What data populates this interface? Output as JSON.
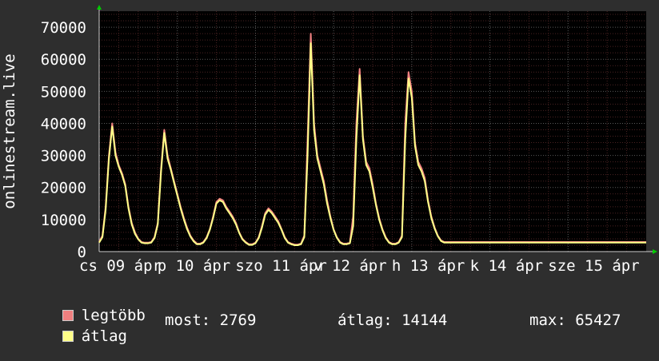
{
  "chart_data": {
    "type": "line",
    "ylabel": "onlinestream.live",
    "ylim": [
      0,
      75000
    ],
    "yticks": [
      0,
      10000,
      20000,
      30000,
      40000,
      50000,
      60000,
      70000
    ],
    "ytick_labels": [
      "0",
      "10000",
      "20000",
      "30000",
      "40000",
      "50000",
      "60000",
      "70000"
    ],
    "xlim": [
      0,
      168
    ],
    "xtick_labels": [
      {
        "x": 0,
        "text": "cs 09 ápr"
      },
      {
        "x": 24,
        "text": "p 10 ápr"
      },
      {
        "x": 48,
        "text": "szo 11 ápr"
      },
      {
        "x": 72,
        "text": "v 12 ápr"
      },
      {
        "x": 96,
        "text": "h 13 ápr"
      },
      {
        "x": 120,
        "text": "k 14 ápr"
      },
      {
        "x": 144,
        "text": "sze 15 ápr"
      }
    ],
    "grid": true,
    "colors": {
      "background": "#2e2e2e",
      "plot_background": "#000000",
      "grid_minor": "#4a2222",
      "grid_major": "#5a5a5a",
      "max_line": "#f08080",
      "avg_line": "#ffff88",
      "axis": "#cccccc",
      "arrow": "#00cc00"
    },
    "series": [
      {
        "name": "legtöbb",
        "color": "#f08080",
        "x": [
          0,
          1,
          2,
          3,
          4,
          5,
          6,
          7,
          8,
          9,
          10,
          11,
          12,
          13,
          14,
          15,
          16,
          17,
          18,
          19,
          20,
          21,
          22,
          23,
          24,
          25,
          26,
          27,
          28,
          29,
          30,
          31,
          32,
          33,
          34,
          35,
          36,
          37,
          38,
          39,
          40,
          41,
          42,
          43,
          44,
          45,
          46,
          47,
          48,
          49,
          50,
          51,
          52,
          53,
          54,
          55,
          56,
          57,
          58,
          59,
          60,
          61,
          62,
          63,
          64,
          65,
          66,
          67,
          68,
          69,
          70,
          71,
          72,
          73,
          74,
          75,
          76,
          77,
          78,
          79,
          80,
          81,
          82,
          83,
          84,
          85,
          86,
          87,
          88,
          89,
          90,
          91,
          92,
          93,
          94,
          95,
          96,
          97,
          98,
          99,
          100,
          101,
          102,
          103,
          104,
          105,
          106,
          107,
          108,
          109,
          110,
          111,
          112,
          113,
          114,
          115,
          116,
          117,
          118,
          119,
          120,
          121,
          122,
          123,
          124,
          125,
          126,
          127,
          128,
          129,
          130,
          131,
          132,
          133,
          134,
          135,
          136,
          137,
          138,
          139,
          140,
          141,
          142,
          143,
          144,
          145,
          146,
          147,
          148,
          149,
          150,
          151,
          152,
          153,
          154,
          155,
          156,
          157,
          158,
          159,
          160,
          161,
          162,
          163,
          164,
          165,
          166,
          167,
          168
        ],
        "values": [
          3000,
          5000,
          14000,
          30000,
          40000,
          31000,
          27000,
          24500,
          21000,
          14000,
          9000,
          6000,
          4000,
          3000,
          2800,
          2800,
          3000,
          4500,
          9000,
          26000,
          38000,
          30000,
          26000,
          22000,
          18000,
          14000,
          10500,
          7500,
          5000,
          3500,
          2500,
          2500,
          3000,
          4500,
          7000,
          11000,
          15500,
          16500,
          16000,
          14000,
          12500,
          11000,
          9000,
          6000,
          4000,
          3000,
          2300,
          2300,
          2800,
          4500,
          8000,
          12000,
          13500,
          12500,
          11000,
          9500,
          7000,
          4500,
          3000,
          2500,
          2200,
          2200,
          2500,
          5000,
          35000,
          68000,
          40000,
          30000,
          26000,
          22000,
          16000,
          11000,
          7000,
          4500,
          3000,
          2500,
          2500,
          2800,
          11000,
          40000,
          57000,
          36000,
          28000,
          26000,
          21000,
          15000,
          10500,
          7000,
          4500,
          3000,
          2500,
          2500,
          3000,
          5000,
          40000,
          56000,
          50000,
          34000,
          28000,
          26000,
          23000,
          16000,
          11000,
          7500,
          5000,
          3500,
          3000,
          3000,
          3000,
          3000,
          3000,
          3000,
          3000,
          3000,
          3000,
          3000,
          3000,
          3000,
          3000,
          3000,
          3000,
          3000,
          3000,
          3000,
          3000,
          3000,
          3000,
          3000,
          3000,
          3000,
          3000,
          3000,
          3000,
          3000,
          3000,
          3000,
          3000,
          3000,
          3000,
          3000,
          3000,
          3000,
          3000,
          3000,
          3000,
          3000,
          3000,
          3000,
          3000,
          3000,
          3000,
          3000,
          3000,
          3000,
          3000,
          3000,
          3000,
          3000,
          3000,
          3000,
          3000,
          3000,
          3000,
          3000,
          3000,
          3000,
          3000,
          3000,
          3000
        ]
      },
      {
        "name": "átlag",
        "color": "#ffff88",
        "x": [
          0,
          1,
          2,
          3,
          4,
          5,
          6,
          7,
          8,
          9,
          10,
          11,
          12,
          13,
          14,
          15,
          16,
          17,
          18,
          19,
          20,
          21,
          22,
          23,
          24,
          25,
          26,
          27,
          28,
          29,
          30,
          31,
          32,
          33,
          34,
          35,
          36,
          37,
          38,
          39,
          40,
          41,
          42,
          43,
          44,
          45,
          46,
          47,
          48,
          49,
          50,
          51,
          52,
          53,
          54,
          55,
          56,
          57,
          58,
          59,
          60,
          61,
          62,
          63,
          64,
          65,
          66,
          67,
          68,
          69,
          70,
          71,
          72,
          73,
          74,
          75,
          76,
          77,
          78,
          79,
          80,
          81,
          82,
          83,
          84,
          85,
          86,
          87,
          88,
          89,
          90,
          91,
          92,
          93,
          94,
          95,
          96,
          97,
          98,
          99,
          100,
          101,
          102,
          103,
          104,
          105,
          106,
          107,
          108,
          109,
          110,
          111,
          112,
          113,
          114,
          115,
          116,
          117,
          118,
          119,
          120,
          121,
          122,
          123,
          124,
          125,
          126,
          127,
          128,
          129,
          130,
          131,
          132,
          133,
          134,
          135,
          136,
          137,
          138,
          139,
          140,
          141,
          142,
          143,
          144,
          145,
          146,
          147,
          148,
          149,
          150,
          151,
          152,
          153,
          154,
          155,
          156,
          157,
          158,
          159,
          160,
          161,
          162,
          163,
          164,
          165,
          166,
          167,
          168
        ],
        "values": [
          2800,
          4500,
          13000,
          29000,
          39000,
          30000,
          26500,
          24000,
          20500,
          13500,
          8500,
          5500,
          3800,
          2800,
          2600,
          2600,
          2800,
          4200,
          8500,
          25000,
          37000,
          29000,
          25500,
          21500,
          17500,
          13500,
          10000,
          7000,
          4700,
          3200,
          2300,
          2300,
          2800,
          4200,
          6800,
          10500,
          15000,
          16000,
          15500,
          13500,
          12000,
          10500,
          8500,
          5800,
          3800,
          2800,
          2100,
          2100,
          2600,
          4200,
          7500,
          11500,
          13000,
          12000,
          10500,
          9000,
          6800,
          4200,
          2800,
          2300,
          2000,
          2000,
          2300,
          4500,
          30000,
          65000,
          38000,
          29000,
          25000,
          21000,
          15000,
          10500,
          6800,
          4300,
          2800,
          2300,
          2300,
          2600,
          8000,
          35000,
          55000,
          35000,
          27000,
          25000,
          20000,
          14500,
          10000,
          6700,
          4200,
          2800,
          2300,
          2300,
          2800,
          4500,
          35000,
          54000,
          48000,
          33000,
          27000,
          25000,
          22000,
          15500,
          10500,
          7200,
          4800,
          3300,
          2800,
          2800,
          2800,
          2800,
          2800,
          2800,
          2800,
          2800,
          2800,
          2800,
          2800,
          2800,
          2800,
          2800,
          2800,
          2800,
          2800,
          2800,
          2800,
          2800,
          2800,
          2800,
          2800,
          2800,
          2800,
          2800,
          2800,
          2800,
          2800,
          2800,
          2800,
          2800,
          2800,
          2800,
          2800,
          2800,
          2800,
          2800,
          2800,
          2800,
          2800,
          2800,
          2800,
          2800,
          2800,
          2800,
          2800,
          2800,
          2800,
          2800,
          2800,
          2800,
          2800,
          2800,
          2800,
          2800,
          2800,
          2800,
          2800,
          2800,
          2800,
          2800,
          2800
        ]
      }
    ]
  },
  "legend": {
    "max_label": "legtöbb",
    "avg_label": "átlag",
    "now_label": "most: 2769",
    "avg_stat_label": "átlag: 14144",
    "max_stat_label": "max: 65427"
  }
}
